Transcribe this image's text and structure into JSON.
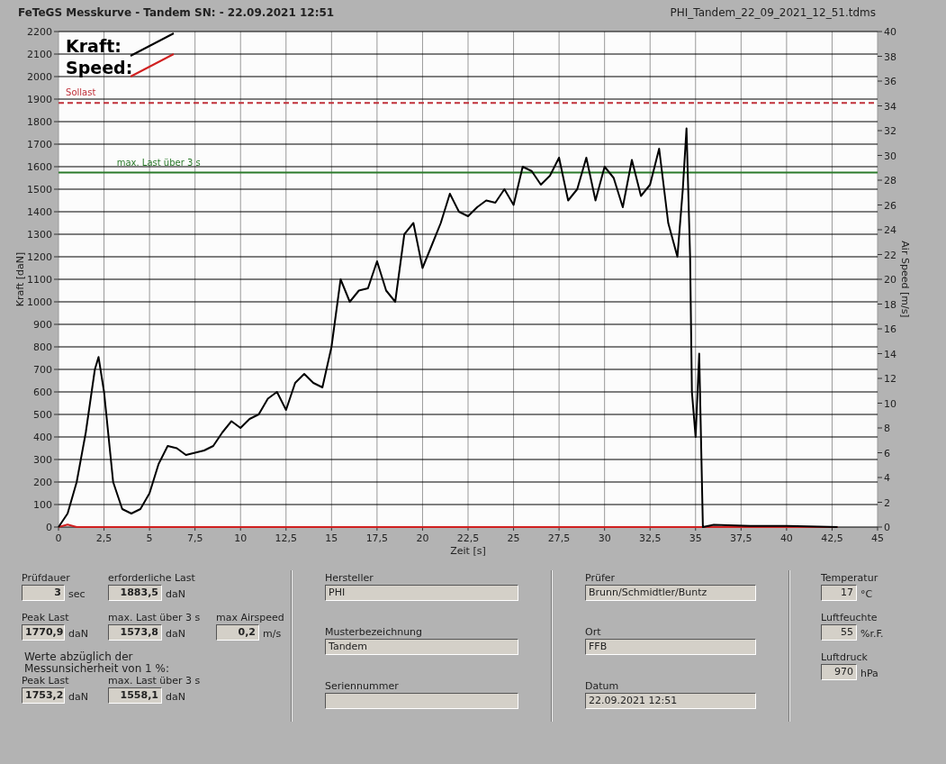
{
  "header": {
    "title": "FeTeGS Messkurve - Tandem  SN:  - 22.09.2021 12:51",
    "file": "PHI_Tandem_22_09_2021_12_51.tdms"
  },
  "chart": {
    "chart_data": {
      "type": "line",
      "xlabel": "Zeit [s]",
      "ylabel": "Kraft [daN]",
      "y2label": "Air Speed [m/s]",
      "xlim": [
        0,
        45
      ],
      "ylim": [
        0,
        2200
      ],
      "y2lim": [
        0,
        40
      ],
      "xticks": [
        0,
        {
          "value": 2.5,
          "label": "2,5"
        },
        5,
        {
          "value": 7.5,
          "label": "7,5"
        },
        10,
        {
          "value": 12.5,
          "label": "12,5"
        },
        15,
        {
          "value": 17.5,
          "label": "17,5"
        },
        20,
        {
          "value": 22.5,
          "label": "22,5"
        },
        25,
        {
          "value": 27.5,
          "label": "27,5"
        },
        30,
        {
          "value": 32.5,
          "label": "32,5"
        },
        35,
        {
          "value": 37.5,
          "label": "37,5"
        },
        40,
        {
          "value": 42.5,
          "label": "42,5"
        },
        45
      ],
      "yticks": [
        0,
        100,
        200,
        300,
        400,
        500,
        600,
        700,
        800,
        900,
        1000,
        1100,
        1200,
        1300,
        1400,
        1500,
        1600,
        1700,
        1800,
        1900,
        2000,
        2100,
        2200
      ],
      "y2ticks": [
        0,
        2,
        4,
        6,
        8,
        10,
        12,
        14,
        16,
        18,
        20,
        22,
        24,
        26,
        28,
        30,
        32,
        34,
        36,
        38,
        40
      ],
      "x": [
        0,
        0.5,
        1,
        1.5,
        2,
        2.2,
        2.5,
        3,
        3.5,
        4,
        4.5,
        5,
        5.5,
        6,
        6.5,
        7,
        7.5,
        8,
        8.5,
        9,
        9.5,
        10,
        10.5,
        11,
        11.5,
        12,
        12.5,
        13,
        13.5,
        14,
        14.5,
        15,
        15.5,
        16,
        16.5,
        17,
        17.5,
        18,
        18.5,
        19,
        19.5,
        20,
        20.5,
        21,
        21.5,
        22,
        22.5,
        23,
        23.5,
        24,
        24.5,
        25,
        25.5,
        26,
        26.5,
        27,
        27.5,
        28,
        28.5,
        29,
        29.5,
        30,
        30.5,
        31,
        31.5,
        32,
        32.5,
        33,
        33.5,
        34,
        34.3,
        34.5,
        34.7,
        34.8,
        35,
        35.2,
        35.4,
        36,
        38,
        40,
        42.8
      ],
      "series": [
        {
          "name": "Kraft:",
          "color": "#000000",
          "values": [
            0,
            60,
            200,
            420,
            700,
            755,
            600,
            200,
            80,
            60,
            80,
            150,
            280,
            360,
            350,
            320,
            330,
            340,
            360,
            420,
            470,
            440,
            480,
            500,
            570,
            600,
            520,
            640,
            680,
            640,
            620,
            800,
            1100,
            1000,
            1050,
            1060,
            1180,
            1050,
            1000,
            1300,
            1350,
            1150,
            1250,
            1350,
            1480,
            1400,
            1380,
            1420,
            1450,
            1440,
            1500,
            1430,
            1600,
            1580,
            1520,
            1560,
            1640,
            1450,
            1500,
            1640,
            1450,
            1600,
            1550,
            1420,
            1630,
            1470,
            1520,
            1680,
            1350,
            1200,
            1500,
            1770,
            1200,
            600,
            400,
            770,
            0,
            10,
            5,
            5,
            0
          ]
        },
        {
          "name": "Speed:",
          "color": "#d02020",
          "axis": "y2",
          "values": [
            0,
            0.2,
            0,
            0,
            0,
            0,
            0,
            0,
            0,
            0,
            0,
            0,
            0,
            0,
            0,
            0,
            0,
            0,
            0,
            0,
            0,
            0,
            0,
            0,
            0,
            0,
            0,
            0,
            0,
            0,
            0,
            0,
            0,
            0,
            0,
            0,
            0,
            0,
            0,
            0,
            0,
            0,
            0,
            0,
            0,
            0,
            0,
            0,
            0,
            0,
            0,
            0,
            0,
            0,
            0,
            0,
            0,
            0,
            0,
            0,
            0,
            0,
            0,
            0,
            0,
            0,
            0,
            0,
            0,
            0,
            0,
            0,
            0,
            0,
            0,
            0,
            0,
            0,
            0,
            0,
            0
          ]
        }
      ],
      "ref_lines": [
        {
          "axis": "y",
          "value": 1883.5,
          "label": "Sollast",
          "color": "#c0303a"
        },
        {
          "axis": "y",
          "value": 1573.8,
          "label": "max. Last über  3 s",
          "color": "#2a7a2a"
        }
      ],
      "grid": true,
      "legend": true
    }
  },
  "results": {
    "rows": [
      [
        {
          "label": "Prüfdauer",
          "value": "3",
          "unit": "sec"
        },
        {
          "label": "erforderliche Last",
          "value": "1883,5",
          "unit": "daN"
        }
      ],
      [
        {
          "label": "Peak Last",
          "value": "1770,9",
          "unit": "daN"
        },
        {
          "label": "max. Last über  3 s",
          "value": "1573,8",
          "unit": "daN"
        },
        {
          "label": "max Airspeed",
          "value": "0,2",
          "unit": "m/s"
        }
      ]
    ],
    "note": [
      "Werte abzüglich der",
      "Messunsicherheit von 1  %:"
    ],
    "corrected": [
      {
        "label": "Peak Last",
        "value": "1753,2",
        "unit": "daN"
      },
      {
        "label": "max. Last über  3 s",
        "value": "1558,1",
        "unit": "daN"
      }
    ]
  },
  "specimen": [
    {
      "label": "Hersteller",
      "value": "PHI"
    },
    {
      "label": "Musterbezeichnung",
      "value": "Tandem"
    },
    {
      "label": "Seriennummer"
    }
  ],
  "test": [
    {
      "label": "Prüfer",
      "value": "Brunn/Schmidtler/Buntz"
    },
    {
      "label": "Ort",
      "value": "FFB"
    },
    {
      "label": "Datum",
      "value": "22.09.2021 12:51"
    }
  ],
  "ambient": [
    {
      "label": "Temperatur",
      "value": "17",
      "unit": "°C"
    },
    {
      "label": "Luftfeuchte",
      "value": "55",
      "unit": "%r.F."
    },
    {
      "label": "Luftdruck",
      "value": "970",
      "unit": "hPa"
    }
  ]
}
